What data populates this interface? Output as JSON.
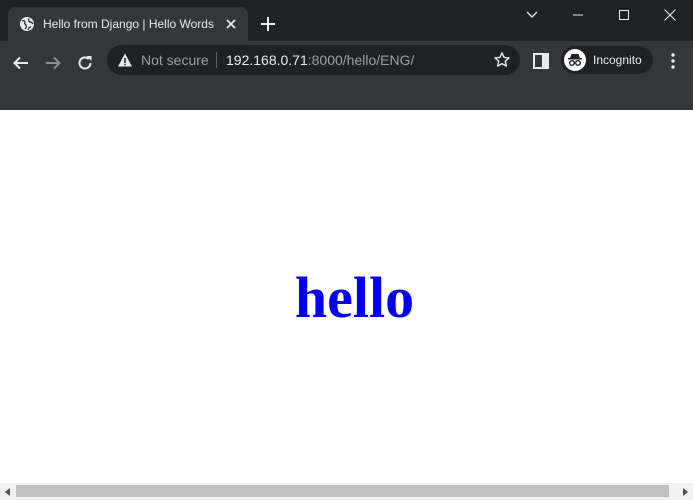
{
  "browser": {
    "tab": {
      "title": "Hello from Django | Hello Words",
      "favicon": "globe-icon"
    },
    "toolbar": {
      "security_label": "Not secure",
      "url_host": "192.168.0.71",
      "url_rest": ":8000/hello/ENG/",
      "profile_label": "Incognito"
    },
    "colors": {
      "frame": "#202124",
      "toolbar": "#35363a",
      "link_blue": "#0000ee"
    }
  },
  "page": {
    "greeting": "hello"
  }
}
